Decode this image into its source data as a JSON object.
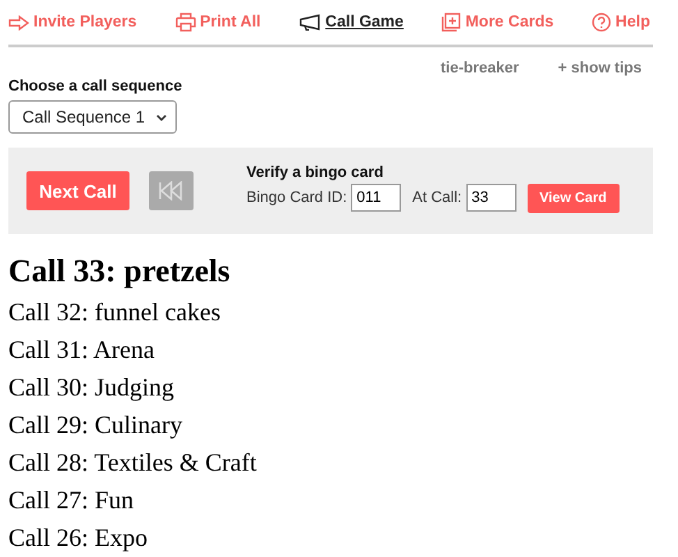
{
  "nav": [
    {
      "kind": "invite",
      "label": "Invite Players",
      "selected": false
    },
    {
      "kind": "print",
      "label": "Print All",
      "selected": false
    },
    {
      "kind": "call",
      "label": "Call Game",
      "selected": true
    },
    {
      "kind": "cards",
      "label": "More Cards",
      "selected": false
    },
    {
      "kind": "help",
      "label": "Help",
      "selected": false
    }
  ],
  "links": [
    "tie-breaker",
    "+ show tips"
  ],
  "sequence": {
    "label": "Choose a call sequence",
    "value": "Call Sequence 1"
  },
  "controls": {
    "next": "Next Call",
    "verify_title": "Verify a bingo card",
    "card_id_label": "Bingo Card ID:",
    "card_id": "011",
    "at_call_label": "At Call:",
    "at_call": "33",
    "view": "View Card"
  },
  "current": "Call 33: pretzels",
  "calls": [
    "Call 32: funnel cakes",
    "Call 31: Arena",
    "Call 30: Judging",
    "Call 29: Culinary",
    "Call 28: Textiles & Craft",
    "Call 27: Fun",
    "Call 26: Expo"
  ]
}
